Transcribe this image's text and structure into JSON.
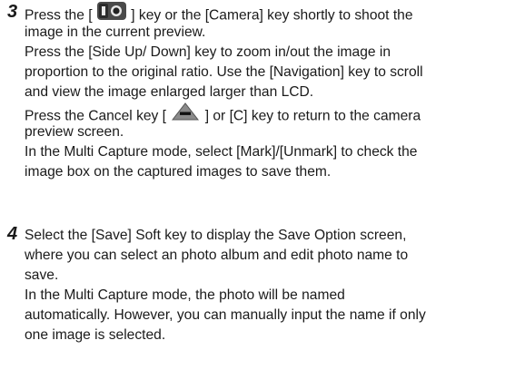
{
  "step3": {
    "number": "3",
    "line1": {
      "pre": "Press the [",
      "post": "] key or the [Camera] key shortly to shoot the"
    },
    "line2": "image in the current preview.",
    "line3": "Press the [Side Up/ Down] key to zoom in/out the image in",
    "line4": "proportion to the original ratio. Use the [Navigation] key to scroll",
    "line5": "and view the image enlarged larger than LCD.",
    "line6": {
      "pre": "Press the Cancel key [",
      "post": "] or [C] key to return to the camera"
    },
    "line7": "preview screen.",
    "line8": "In the Multi Capture mode, select [Mark]/[Unmark] to check the",
    "line9": "image box on the captured images to save them."
  },
  "step4": {
    "number": "4",
    "line1": "Select the [Save] Soft key to display the Save Option screen,",
    "line2": "where you can select an photo album and edit photo name to",
    "line3": "save.",
    "line4": "In the Multi Capture mode, the photo will be named",
    "line5": "automatically. However, you can manually input the name if only",
    "line6": "one image is selected."
  },
  "icons": {
    "camera_key": "camera-key-icon",
    "cancel_key": "cancel-key-icon"
  }
}
